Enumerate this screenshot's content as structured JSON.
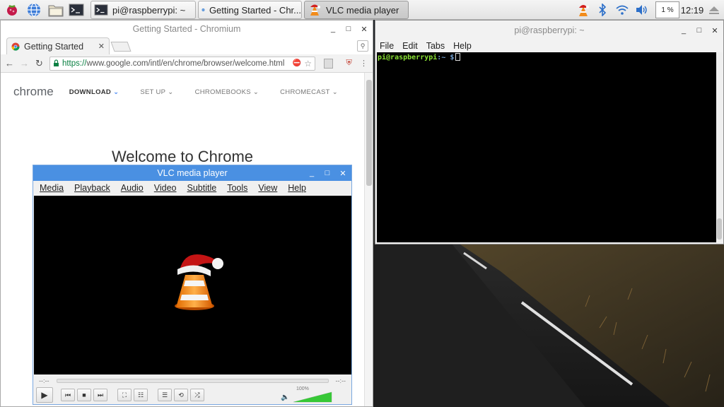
{
  "taskbar": {
    "launchers": [
      {
        "name": "raspberry-menu-icon"
      },
      {
        "name": "web-browser-icon"
      },
      {
        "name": "file-manager-icon"
      },
      {
        "name": "terminal-launcher-icon"
      }
    ],
    "tasks": [
      {
        "label": "pi@raspberrypi: ~",
        "icon": "terminal-icon"
      },
      {
        "label": "Getting Started - Chr...",
        "icon": "chromium-icon"
      },
      {
        "label": "VLC media player",
        "icon": "vlc-icon"
      }
    ],
    "cpu_percent": "1 %",
    "clock": "12:19"
  },
  "chromium": {
    "window_title": "Getting Started - Chromium",
    "tab_title": "Getting Started",
    "url_scheme": "https://",
    "url_rest": "www.google.com/intl/en/chrome/browser/welcome.html",
    "page": {
      "logo_text": "chrome",
      "nav": [
        "DOWNLOAD",
        "SET UP",
        "CHROMEBOOKS",
        "CHROMECAST"
      ],
      "heading": "Welcome to Chrome"
    }
  },
  "vlc": {
    "window_title": "VLC media player",
    "menu": [
      "Media",
      "Playback",
      "Audio",
      "Video",
      "Subtitle",
      "Tools",
      "View",
      "Help"
    ],
    "time_elapsed": "--:--",
    "time_total": "--:--",
    "volume_label": "100%",
    "volume_level": 1.0
  },
  "terminal": {
    "window_title": "pi@raspberrypi: ~",
    "menu": [
      "File",
      "Edit",
      "Tabs",
      "Help"
    ],
    "prompt_user": "pi@raspberrypi",
    "prompt_path": ":~ $"
  },
  "colors": {
    "vlc_title": "#4a90e2",
    "chrome_blue": "#4285f4",
    "terminal_green": "#8ae234",
    "terminal_blue": "#729fcf"
  }
}
